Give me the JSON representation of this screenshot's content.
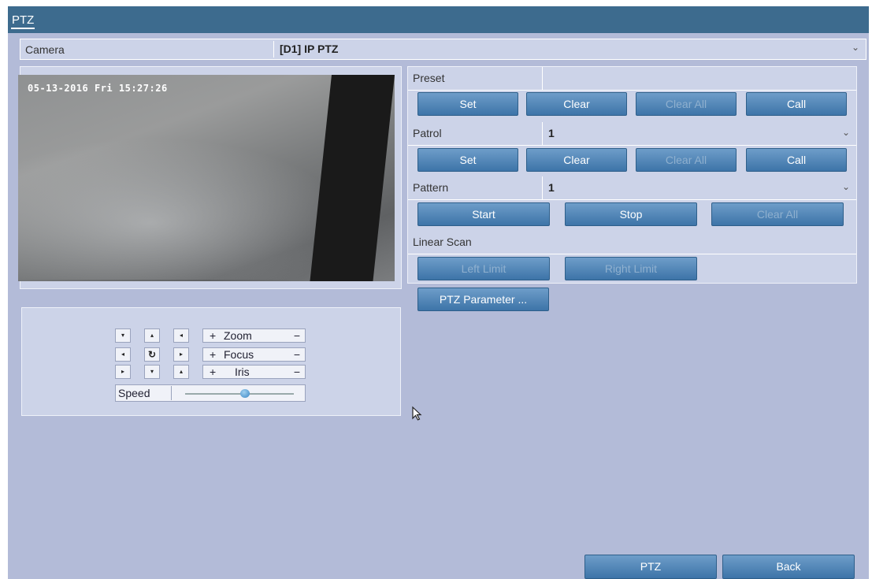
{
  "window": {
    "title": "PTZ"
  },
  "camera": {
    "label": "Camera",
    "value": "[D1] IP PTZ"
  },
  "video": {
    "osd_timestamp": "05-13-2016 Fri 15:27:26"
  },
  "preset": {
    "label": "Preset",
    "value": "",
    "buttons": {
      "set": "Set",
      "clear": "Clear",
      "clear_all": "Clear All",
      "call": "Call"
    }
  },
  "patrol": {
    "label": "Patrol",
    "value": "1",
    "buttons": {
      "set": "Set",
      "clear": "Clear",
      "clear_all": "Clear All",
      "call": "Call"
    }
  },
  "pattern": {
    "label": "Pattern",
    "value": "1",
    "buttons": {
      "start": "Start",
      "stop": "Stop",
      "clear_all": "Clear All"
    }
  },
  "linear_scan": {
    "label": "Linear Scan",
    "buttons": {
      "left_limit": "Left Limit",
      "right_limit": "Right Limit"
    }
  },
  "ptz_parameter_button": "PTZ Parameter ...",
  "control_pad": {
    "zoom": {
      "plus": "+",
      "label": "Zoom",
      "minus": "−"
    },
    "focus": {
      "plus": "+",
      "label": "Focus",
      "minus": "−"
    },
    "iris": {
      "plus": "+",
      "label": "Iris",
      "minus": "−"
    },
    "speed_label": "Speed",
    "speed_level": 0.55
  },
  "footer": {
    "ptz_button": "PTZ",
    "back_button": "Back"
  },
  "colors": {
    "titlebar": "#3d6b8e",
    "background": "#b3bbd8",
    "button": "#3d74a8"
  }
}
